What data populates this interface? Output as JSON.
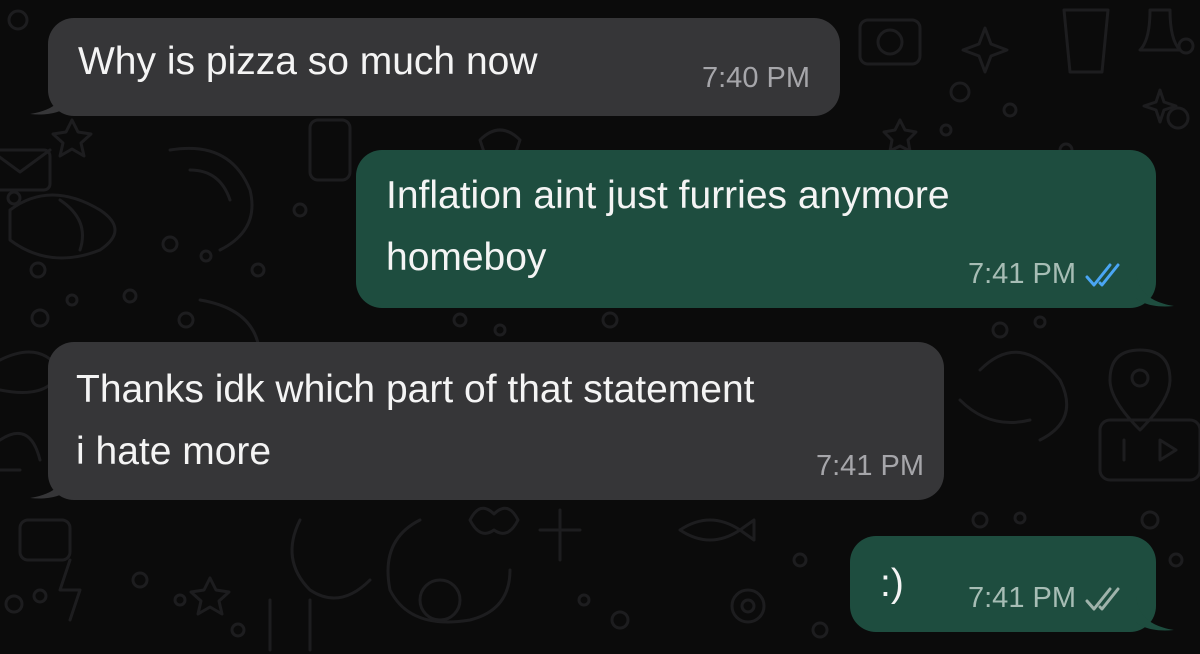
{
  "messages": [
    {
      "direction": "incoming",
      "lines": [
        "Why is pizza so much now"
      ],
      "time": "7:40 PM"
    },
    {
      "direction": "outgoing",
      "lines": [
        "Inflation aint just furries anymore",
        "homeboy"
      ],
      "time": "7:41 PM",
      "status": "read",
      "status_icon": "double-check-icon",
      "status_color": "#4aa6f4"
    },
    {
      "direction": "incoming",
      "lines": [
        "Thanks idk which part of that statement",
        "i hate more"
      ],
      "time": "7:41 PM"
    },
    {
      "direction": "outgoing",
      "lines": [
        ":)"
      ],
      "time": "7:41 PM",
      "status": "delivered",
      "status_icon": "double-check-icon",
      "status_color": "#9fb3ab"
    }
  ],
  "colors": {
    "background": "#0b0b0b",
    "incoming_bubble": "#363638",
    "outgoing_bubble": "#1e4d3f",
    "read_tick": "#4aa6f4"
  }
}
